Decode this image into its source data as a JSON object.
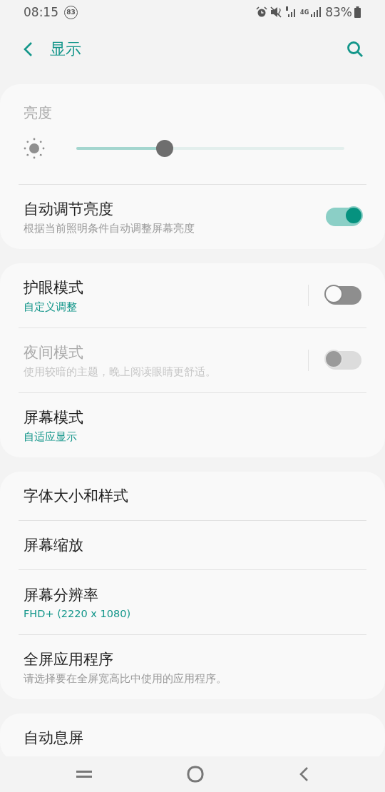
{
  "status_bar": {
    "time": "08:15",
    "badge": "83",
    "network": "4G",
    "battery_text": "83%"
  },
  "header": {
    "title": "显示"
  },
  "groups": [
    {
      "items": [
        {
          "kind": "slider",
          "title": "亮度",
          "level": 0.33
        },
        {
          "kind": "switch",
          "title": "自动调节亮度",
          "subtitle": "根据当前照明条件自动调整屏幕亮度",
          "on": true,
          "disabled": false,
          "accent": false,
          "divider": false
        }
      ]
    },
    {
      "items": [
        {
          "kind": "switch",
          "title": "护眼模式",
          "subtitle": "自定义调整",
          "on": false,
          "disabled": false,
          "accent": true,
          "divider": true
        },
        {
          "kind": "switch",
          "title": "夜间模式",
          "subtitle": "使用较暗的主题，晚上阅读眼睛更舒适。",
          "on": false,
          "disabled": true,
          "accent": false,
          "divider": true
        },
        {
          "kind": "link",
          "title": "屏幕模式",
          "subtitle": "自适应显示",
          "accent": true
        }
      ]
    },
    {
      "items": [
        {
          "kind": "link",
          "title": "字体大小和样式"
        },
        {
          "kind": "link",
          "title": "屏幕缩放"
        },
        {
          "kind": "link",
          "title": "屏幕分辨率",
          "subtitle": "FHD+ (2220 x 1080)",
          "accent": true
        },
        {
          "kind": "link",
          "title": "全屏应用程序",
          "subtitle": "请选择要在全屏宽高比中使用的应用程序。",
          "accent": false
        }
      ]
    },
    {
      "items": [
        {
          "kind": "link",
          "title": "自动息屏"
        }
      ]
    }
  ]
}
